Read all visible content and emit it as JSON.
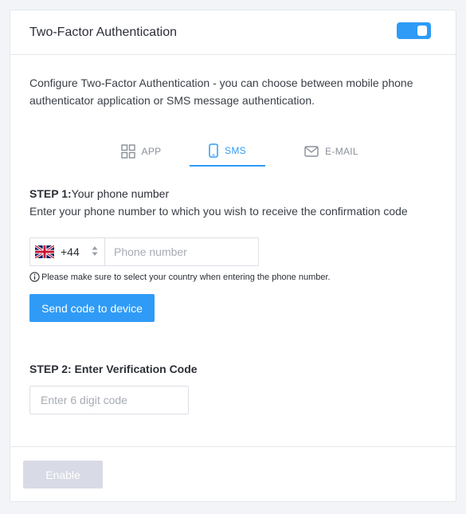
{
  "header": {
    "title": "Two-Factor Authentication",
    "toggle_enabled": true,
    "accent_color": "#2f9bf7"
  },
  "description": "Configure Two-Factor Authentication - you can choose between mobile phone authenticator application or SMS message authentication.",
  "tabs": [
    {
      "label": "APP",
      "icon": "grid-icon",
      "active": false
    },
    {
      "label": "SMS",
      "icon": "mobile-phone-icon",
      "active": true
    },
    {
      "label": "E-MAIL",
      "icon": "envelope-icon",
      "active": false
    }
  ],
  "step1": {
    "title_bold": "STEP 1:",
    "title_rest": "Your phone number",
    "description": "Enter your phone number to which you wish to receive the confirmation code",
    "country_flag": "uk-flag-icon",
    "dial_code": "+44",
    "phone_placeholder": "Phone number",
    "phone_value": "",
    "hint": "Please make sure to select your country when entering the phone number.",
    "send_button": "Send code to device"
  },
  "step2": {
    "title": "STEP 2: Enter Verification Code",
    "code_placeholder": "Enter 6 digit code",
    "code_value": ""
  },
  "footer": {
    "enable_button": "Enable",
    "enable_disabled": true
  }
}
